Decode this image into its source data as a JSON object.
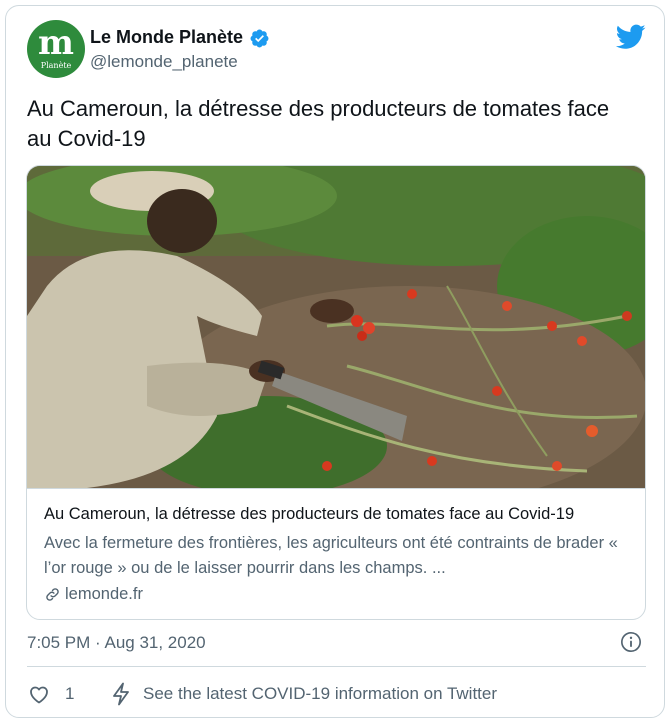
{
  "account": {
    "avatar_glyph": "m",
    "avatar_sub": "Planète",
    "name": "Le Monde Planète",
    "handle": "@lemonde_planete",
    "verified": true
  },
  "tweet": {
    "text": "Au Cameroun, la détresse des producteurs de tomates face au Covid-19",
    "timestamp": "7:05 PM · Aug 31, 2020"
  },
  "card": {
    "title": "Au Cameroun, la détresse des producteurs de tomates face au Covid-19",
    "description": "Avec la fermeture des frontières, les agriculteurs ont été contraints de brader « l’or rouge » ou de le laisser pourrir dans les champs. ...",
    "domain": "lemonde.fr"
  },
  "actions": {
    "like_count": "1",
    "covid_notice": "See the latest COVID-19 information on Twitter"
  },
  "colors": {
    "brand_blue": "#1d9bf0",
    "avatar_green": "#2e8b3c",
    "secondary_text": "#536471",
    "border": "#cfd9de"
  },
  "icons": [
    "verified-badge-icon",
    "twitter-bird-icon",
    "link-icon",
    "info-icon",
    "heart-icon",
    "lightning-icon"
  ]
}
